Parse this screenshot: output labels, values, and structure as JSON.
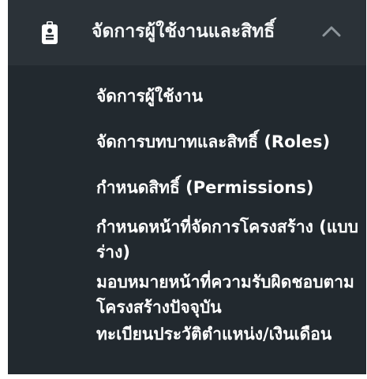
{
  "menu": {
    "header": {
      "label": "จัดการผู้ใช้งานและสิทธิ์",
      "icon": "id-badge-icon",
      "chevron_icon": "chevron-up-icon"
    },
    "items": [
      {
        "label": "จัดการผู้ใช้งาน"
      },
      {
        "label": "จัดการบทบาทและสิทธิ์ (Roles)"
      },
      {
        "label": "กำหนดสิทธิ์ (Permissions)"
      },
      {
        "label": "กำหนดหน้าที่จัดการโครงสร้าง (แบบร่าง)"
      },
      {
        "label": "มอบหมายหน้าที่ความรับผิดชอบตามโครงสร้างปัจจุบัน"
      },
      {
        "label": "ทะเบียนประวัติตำแหน่ง/เงินเดือน"
      }
    ]
  },
  "colors": {
    "panel_bg": "#22292f",
    "header_bg": "#2b3238",
    "text": "#ffffff",
    "chevron": "#8e969c"
  }
}
